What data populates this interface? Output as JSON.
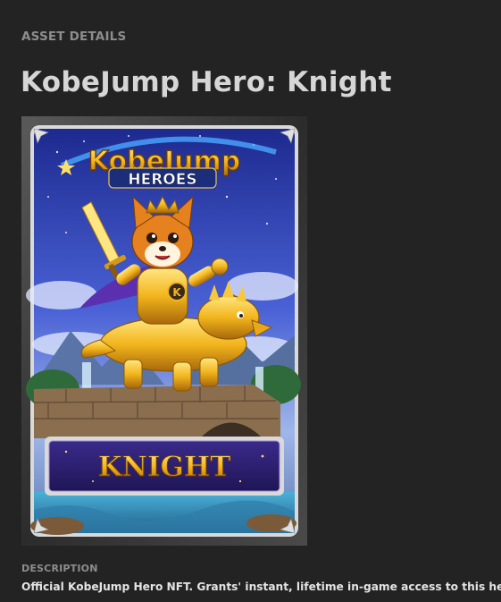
{
  "header": {
    "section_label": "ASSET DETAILS",
    "title": "KobeJump Hero: Knight"
  },
  "card": {
    "logo_line1": "KobeJump",
    "logo_line2": "HEROES",
    "badge_letter": "K",
    "class_name": "KNIGHT"
  },
  "description": {
    "label": "DESCRIPTION",
    "text": "Official KobeJump Hero NFT. Grants' instant, lifetime in-game access to this hero."
  },
  "colors": {
    "background": "#232323",
    "label": "#8d8d8d",
    "title": "#d6d6d6",
    "text": "#e4e4e4",
    "gold": "#f2b51d",
    "card_sky": "#3d4fc8",
    "banner": "#2f2274"
  }
}
